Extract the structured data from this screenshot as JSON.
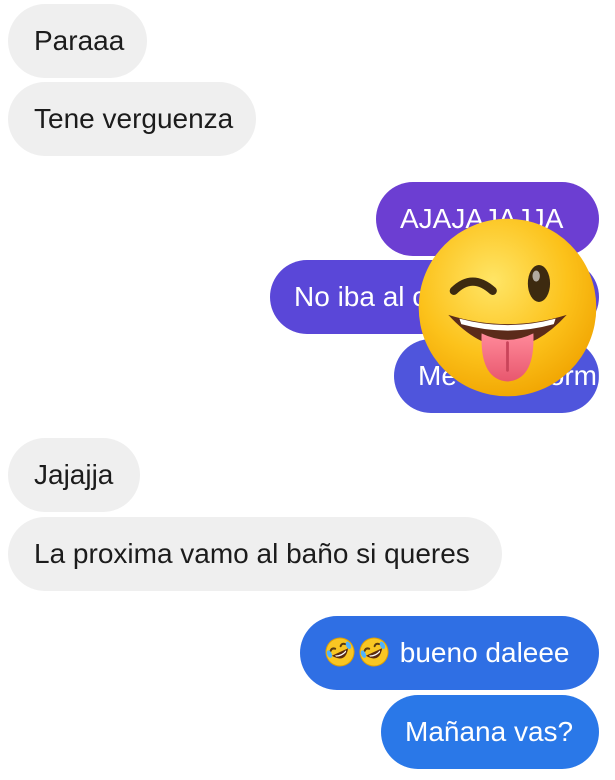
{
  "conversation": {
    "messages": [
      {
        "direction": "incoming",
        "text": "Paraaa"
      },
      {
        "direction": "incoming",
        "text": "Tene verguenza"
      },
      {
        "direction": "outgoing",
        "text": "AJAJAJAJJA"
      },
      {
        "direction": "outgoing",
        "text": "No iba al colegio"
      },
      {
        "direction": "outgoing",
        "text": "Me iba a dormir"
      },
      {
        "direction": "incoming",
        "text": "Jajajja"
      },
      {
        "direction": "incoming",
        "text": "La proxima vamo al baño si queres"
      },
      {
        "direction": "outgoing",
        "emojis": [
          "rolling-on-floor-laughing",
          "rolling-on-floor-laughing"
        ],
        "text": "bueno daleee"
      },
      {
        "direction": "outgoing",
        "text": "Mañana vas?"
      }
    ],
    "sticker": {
      "emoji": "winking-face-with-tongue"
    }
  },
  "colors": {
    "incoming_bubble": "#efefef",
    "incoming_text": "#1c1c1c",
    "outgoing_gradient_top": "#6c3ed2",
    "outgoing_gradient_bottom": "#2a78e8",
    "outgoing_text": "#ffffff"
  }
}
